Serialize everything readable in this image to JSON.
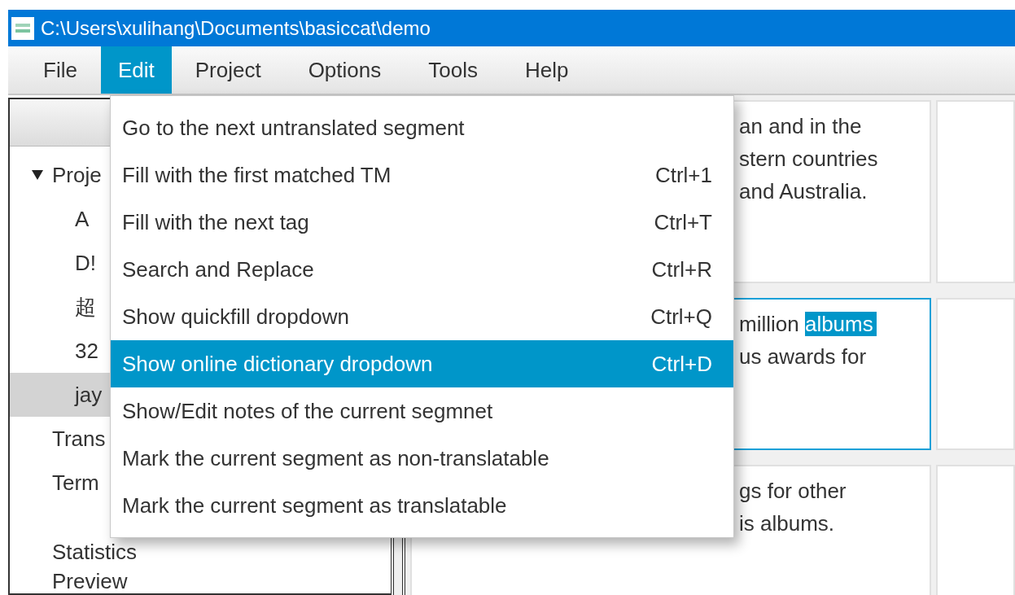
{
  "window": {
    "title": "C:\\Users\\xulihang\\Documents\\basiccat\\demo"
  },
  "menu_bar": [
    {
      "label": "File",
      "selected": false
    },
    {
      "label": "Edit",
      "selected": true
    },
    {
      "label": "Project",
      "selected": false
    },
    {
      "label": "Options",
      "selected": false
    },
    {
      "label": "Tools",
      "selected": false
    },
    {
      "label": "Help",
      "selected": false
    }
  ],
  "sidebar": {
    "tree": [
      {
        "label": "Proje",
        "expanded": true,
        "selected": false,
        "children": [
          {
            "label": "A",
            "selected": false
          },
          {
            "label": "D!",
            "selected": false
          },
          {
            "label": "超",
            "selected": false
          },
          {
            "label": "32",
            "selected": false
          },
          {
            "label": "jay",
            "selected": true
          }
        ]
      },
      {
        "label": "Trans",
        "selected": false
      },
      {
        "label": "Term",
        "selected": false
      },
      {
        "label": "Statistics",
        "selected": false
      },
      {
        "label": "Preview",
        "selected": false
      }
    ]
  },
  "segments": [
    {
      "focused": false,
      "lines": [
        [
          {
            "text": "an and in the",
            "selected": false
          }
        ],
        [
          {
            "text": "stern countries",
            "selected": false
          }
        ],
        [
          {
            "text": "and Australia.",
            "selected": false
          }
        ]
      ]
    },
    {
      "focused": true,
      "lines": [
        [
          {
            "text": "million ",
            "selected": false
          },
          {
            "text": "albums",
            "selected": true
          }
        ],
        [
          {
            "text": "us awards for",
            "selected": false
          }
        ]
      ]
    },
    {
      "focused": false,
      "lines": [
        [
          {
            "text": "gs for other",
            "selected": false
          }
        ],
        [
          {
            "text": "is albums.",
            "selected": false
          }
        ]
      ]
    }
  ],
  "edit_menu": {
    "items": [
      {
        "label": "Go to the next untranslated segment",
        "selected": false
      },
      {
        "label": "Fill with the first matched TM",
        "shortcut": "Ctrl+1",
        "selected": false
      },
      {
        "label": "Fill with the next tag",
        "shortcut": "Ctrl+T",
        "selected": false
      },
      {
        "label": "Search and Replace",
        "shortcut": "Ctrl+R",
        "selected": false
      },
      {
        "label": "Show quickfill dropdown",
        "shortcut": "Ctrl+Q",
        "selected": false
      },
      {
        "label": "Show online dictionary dropdown",
        "shortcut": "Ctrl+D",
        "selected": true
      },
      {
        "label": "Show/Edit notes of the current segmnet",
        "selected": false
      },
      {
        "label": "Mark the current segment as non-translatable",
        "selected": false
      },
      {
        "label": "Mark the current segment as translatable",
        "selected": false
      }
    ]
  }
}
